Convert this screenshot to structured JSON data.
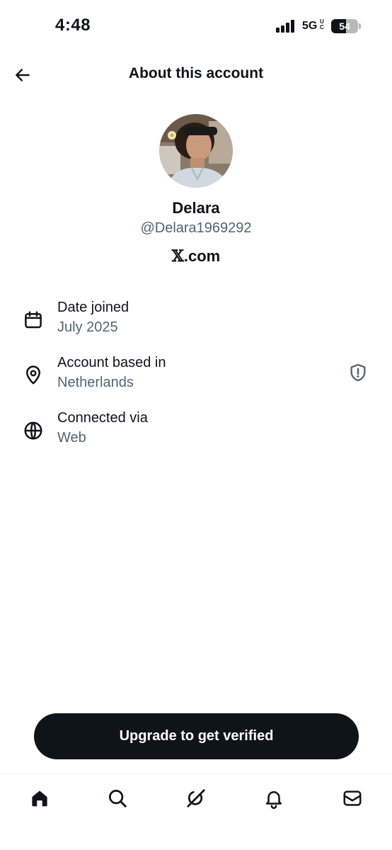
{
  "status_bar": {
    "time": "4:48",
    "network": "5G",
    "network_superscript": "UC",
    "battery_level": 54,
    "battery_text": "54"
  },
  "header": {
    "title": "About this account",
    "back_icon": "arrow-left-icon"
  },
  "profile": {
    "display_name": "Delara",
    "handle": "@Delara1969292",
    "site_mark": "𝕏",
    "site_suffix": ".com"
  },
  "info_rows": [
    {
      "icon": "calendar-icon",
      "label": "Date joined",
      "value": "July 2025"
    },
    {
      "icon": "location-pin-icon",
      "label": "Account based in",
      "value": "Netherlands",
      "trailing_icon": "shield-alert-icon"
    },
    {
      "icon": "globe-icon",
      "label": "Connected via",
      "value": "Web"
    }
  ],
  "upgrade_button": {
    "label": "Upgrade to get verified"
  },
  "bottom_nav": {
    "items": [
      {
        "icon": "home-icon",
        "active": true
      },
      {
        "icon": "search-icon",
        "active": false
      },
      {
        "icon": "grok-icon",
        "active": false
      },
      {
        "icon": "bell-icon",
        "active": false
      },
      {
        "icon": "mail-icon",
        "active": false
      }
    ]
  },
  "colors": {
    "text_primary": "#0f1419",
    "text_secondary": "#536471",
    "button_bg": "#0f1419",
    "button_text": "#ffffff",
    "background": "#ffffff"
  }
}
